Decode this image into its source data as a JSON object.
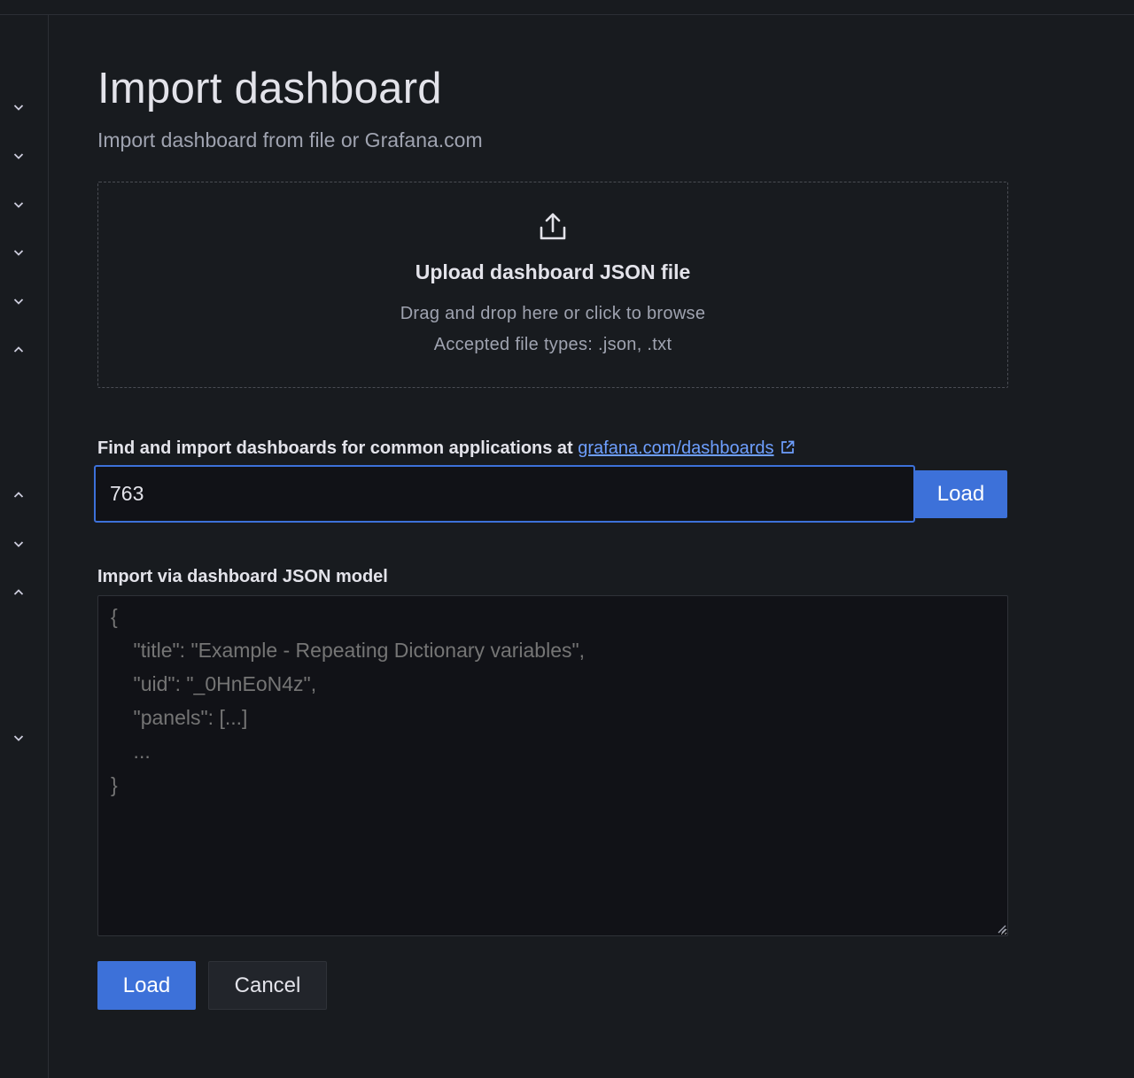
{
  "sidebar": {
    "toggles": [
      {
        "icon": "chevron-down-icon"
      },
      {
        "icon": "chevron-down-icon"
      },
      {
        "icon": "chevron-down-icon"
      },
      {
        "icon": "chevron-down-icon"
      },
      {
        "icon": "chevron-down-icon"
      },
      {
        "icon": "chevron-up-icon"
      },
      {
        "icon": "chevron-up-icon"
      },
      {
        "icon": "chevron-down-icon"
      },
      {
        "icon": "chevron-up-icon"
      },
      {
        "icon": "chevron-down-icon"
      }
    ]
  },
  "page": {
    "title": "Import dashboard",
    "subtitle": "Import dashboard from file or Grafana.com"
  },
  "upload": {
    "icon": "upload-icon",
    "title": "Upload dashboard JSON file",
    "hint": "Drag and drop here or click to browse",
    "accepted": "Accepted file types: .json, .txt"
  },
  "grafana_com": {
    "label": "Find and import dashboards for common applications at ",
    "link_text": "grafana.com/dashboards",
    "link_icon": "external-link-icon",
    "input_value": "763",
    "load_label": "Load"
  },
  "json_model": {
    "label": "Import via dashboard JSON model",
    "placeholder": "{\n    \"title\": \"Example - Repeating Dictionary variables\",\n    \"uid\": \"_0HnEoN4z\",\n    \"panels\": [...]\n    ...\n}"
  },
  "actions": {
    "load_label": "Load",
    "cancel_label": "Cancel"
  },
  "colors": {
    "background": "#181b1f",
    "primary": "#3d71d9",
    "link": "#6e9fff",
    "input_bg": "#111217"
  }
}
